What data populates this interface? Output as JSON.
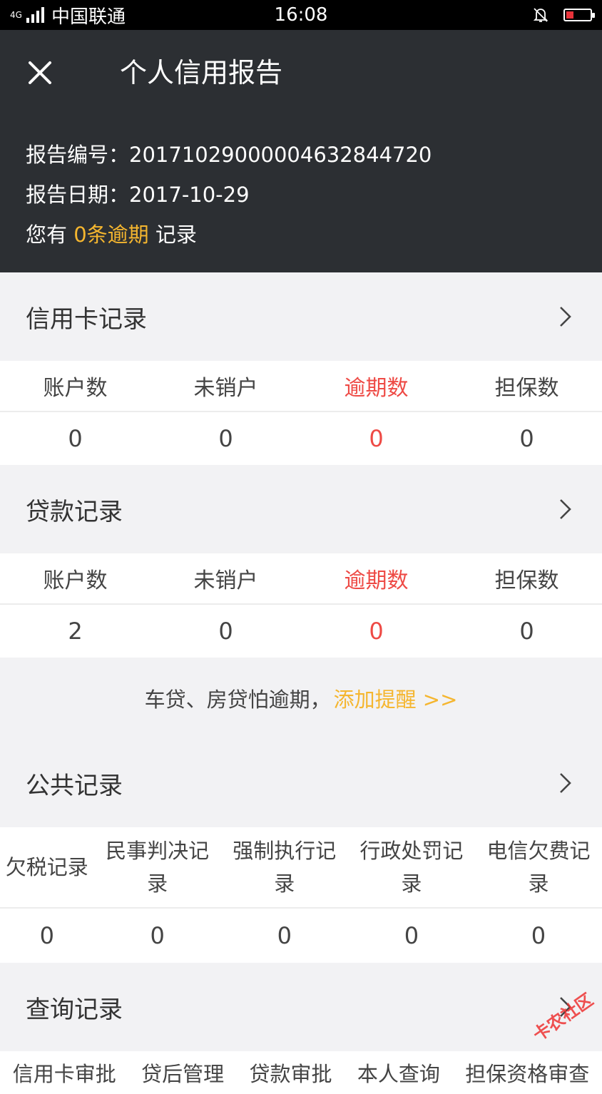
{
  "status_bar": {
    "network": "4G",
    "carrier": "中国联通",
    "time": "16:08"
  },
  "header": {
    "title": "个人信用报告",
    "report_no_label": "报告编号：",
    "report_no": "20171029000004632844720",
    "report_date_label": "报告日期：",
    "report_date": "2017-10-29",
    "overdue_prefix": "您有 ",
    "overdue_highlight": "0条逾期",
    "overdue_suffix": " 记录"
  },
  "credit_card": {
    "title": "信用卡记录",
    "columns": [
      "账户数",
      "未销户",
      "逾期数",
      "担保数"
    ],
    "values": [
      "0",
      "0",
      "0",
      "0"
    ]
  },
  "loan": {
    "title": "贷款记录",
    "columns": [
      "账户数",
      "未销户",
      "逾期数",
      "担保数"
    ],
    "values": [
      "2",
      "0",
      "0",
      "0"
    ]
  },
  "reminder": {
    "text": "车贷、房贷怕逾期，",
    "link": "添加提醒 >>"
  },
  "public_records": {
    "title": "公共记录",
    "columns": [
      "欠税记录",
      "民事判决记录",
      "强制执行记录",
      "行政处罚记录",
      "电信欠费记录"
    ],
    "values": [
      "0",
      "0",
      "0",
      "0",
      "0"
    ]
  },
  "query_records": {
    "title": "查询记录",
    "columns": [
      "信用卡审批",
      "贷后管理",
      "贷款审批",
      "本人查询",
      "担保资格审查"
    ]
  },
  "watermark": "卡农社区",
  "colors": {
    "header_bg": "#2c2f33",
    "accent": "#f5b62f",
    "overdue_red": "#ee4a45"
  }
}
